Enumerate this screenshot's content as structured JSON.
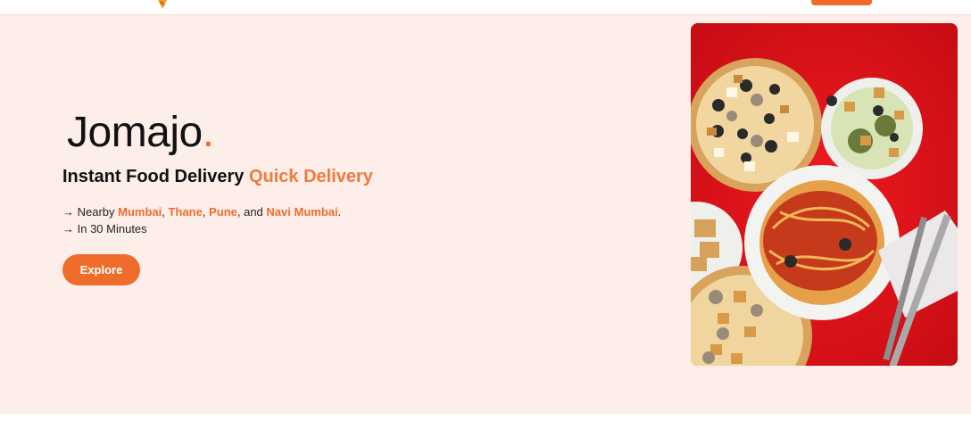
{
  "header": {
    "logo_icon": "pizza-slice-icon",
    "cta_color": "#ef6c2b"
  },
  "hero": {
    "brand_name": "Jomajo",
    "brand_dot": ".",
    "headline_main": "Instant Food Delivery",
    "headline_accent": "Quick Delivery",
    "nearby_prefix": "→ Nearby",
    "cities": [
      "Mumbai",
      "Thane",
      "Pune",
      "Navi Mumbai"
    ],
    "separator_comma": ",",
    "separator_and": ", and",
    "period": ".",
    "timing": "→ In 30 Minutes",
    "explore_label": "Explore",
    "image_alt": "pizza-and-spaghetti-photo"
  },
  "colors": {
    "accent": "#ef6c2b",
    "hero_bg": "#fdeeea",
    "image_bg": "#e0141b"
  }
}
